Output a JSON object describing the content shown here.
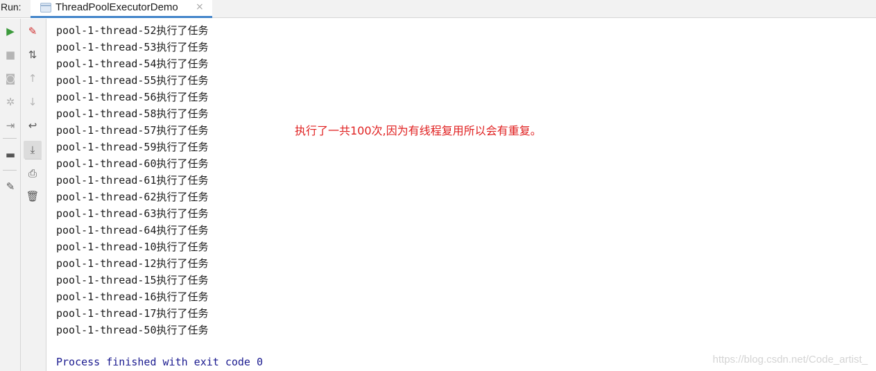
{
  "run_panel": {
    "label": "Run:",
    "tab_title": "ThreadPoolExecutorDemo",
    "tab_close": "×"
  },
  "toolbar_left": [
    {
      "name": "rerun-icon",
      "glyph": "▶",
      "color": "#3c9a3c"
    },
    {
      "name": "stop-icon",
      "glyph": "■",
      "color": "#b5b5b5"
    },
    {
      "name": "camera-icon",
      "glyph": "◙",
      "color": "#b5b5b5"
    },
    {
      "name": "debug-icon",
      "glyph": "✲",
      "color": "#b5b5b5"
    },
    {
      "name": "exit-icon",
      "glyph": "⇥",
      "color": "#8c8c8c"
    },
    {
      "name": "layout-icon",
      "glyph": "▬",
      "color": "#555555"
    },
    {
      "name": "pin-icon",
      "glyph": "✎",
      "color": "#555555"
    }
  ],
  "toolbar_right": [
    {
      "name": "clear-edit-icon",
      "glyph": "✎",
      "color": "#d03030"
    },
    {
      "name": "sort-icon",
      "glyph": "⇅",
      "color": "#555555"
    },
    {
      "name": "up-arrow-icon",
      "glyph": "↑",
      "color": "#b5b5b5"
    },
    {
      "name": "down-arrow-icon",
      "glyph": "↓",
      "color": "#b5b5b5"
    },
    {
      "name": "soft-wrap-icon",
      "glyph": "↩",
      "color": "#555555"
    },
    {
      "name": "scroll-to-end-icon",
      "glyph": "⤓",
      "color": "#555555"
    },
    {
      "name": "print-icon",
      "glyph": "⎙",
      "color": "#555555"
    },
    {
      "name": "trash-icon",
      "glyph": "🗑",
      "color": "#555555"
    }
  ],
  "console": {
    "lines": [
      "pool-1-thread-52执行了任务",
      "pool-1-thread-53执行了任务",
      "pool-1-thread-54执行了任务",
      "pool-1-thread-55执行了任务",
      "pool-1-thread-56执行了任务",
      "pool-1-thread-58执行了任务",
      "pool-1-thread-57执行了任务",
      "pool-1-thread-59执行了任务",
      "pool-1-thread-60执行了任务",
      "pool-1-thread-61执行了任务",
      "pool-1-thread-62执行了任务",
      "pool-1-thread-63执行了任务",
      "pool-1-thread-64执行了任务",
      "pool-1-thread-10执行了任务",
      "pool-1-thread-12执行了任务",
      "pool-1-thread-15执行了任务",
      "pool-1-thread-16执行了任务",
      "pool-1-thread-17执行了任务",
      "pool-1-thread-50执行了任务"
    ],
    "process_finished": "Process finished with exit code 0"
  },
  "annotation": "执行了一共100次,因为有线程复用所以会有重复。",
  "watermark": "https://blog.csdn.net/Code_artist_",
  "colors": {
    "annotation": "#e02020",
    "process_text": "#1a1a8f",
    "tab_underline": "#4083c9"
  }
}
